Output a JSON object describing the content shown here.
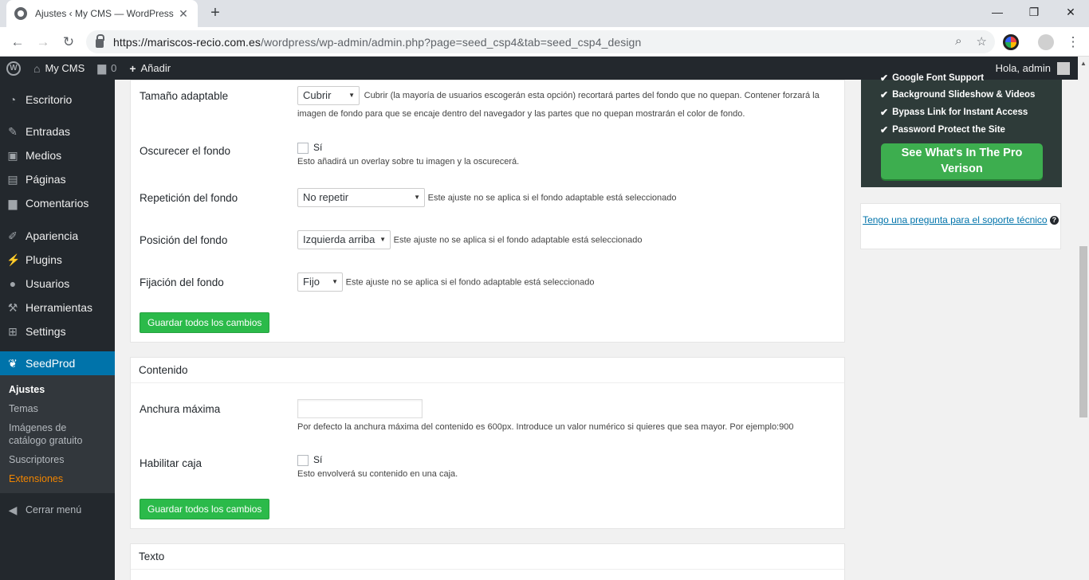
{
  "browser": {
    "tab_title": "Ajustes ‹ My CMS — WordPress",
    "url_host": "https://mariscos-recio.com.es",
    "url_path": "/wordpress/wp-admin/admin.php?page=seed_csp4&tab=seed_csp4_design"
  },
  "adminbar": {
    "site_name": "My CMS",
    "comments_count": "0",
    "add_label": "Añadir",
    "howdy": "Hola, admin"
  },
  "sidebar": {
    "items": [
      {
        "label": "Escritorio",
        "icon": "dashboard-icon"
      },
      {
        "label": "Entradas",
        "icon": "pin-icon"
      },
      {
        "label": "Medios",
        "icon": "media-icon"
      },
      {
        "label": "Páginas",
        "icon": "page-icon"
      },
      {
        "label": "Comentarios",
        "icon": "comment-icon"
      },
      {
        "label": "Apariencia",
        "icon": "brush-icon"
      },
      {
        "label": "Plugins",
        "icon": "plugin-icon"
      },
      {
        "label": "Usuarios",
        "icon": "user-icon"
      },
      {
        "label": "Herramientas",
        "icon": "wrench-icon"
      },
      {
        "label": "Settings",
        "icon": "settings-icon"
      },
      {
        "label": "SeedProd",
        "icon": "seedprod-icon"
      }
    ],
    "submenu": [
      "Ajustes",
      "Temas",
      "Imágenes de catálogo gratuito",
      "Suscriptores",
      "Extensiones"
    ],
    "collapse": "Cerrar menú"
  },
  "background": {
    "size_label": "Tamaño adaptable",
    "size_value": "Cubrir",
    "size_desc": "Cubrir (la mayoría de usuarios escogerán esta opción) recortará partes del fondo que no quepan. Contener forzará la imagen de fondo para que se encaje dentro del navegador y las partes que no quepan mostrarán el color de fondo.",
    "darken_label": "Oscurecer el fondo",
    "darken_check": "Sí",
    "darken_desc": "Esto añadirá un overlay sobre tu imagen y la oscurecerá.",
    "repeat_label": "Repetición del fondo",
    "repeat_value": "No repetir",
    "repeat_desc": "Este ajuste no se aplica si el fondo adaptable está seleccionado",
    "position_label": "Posición del fondo",
    "position_value": "Izquierda arriba",
    "position_desc": "Este ajuste no se aplica si el fondo adaptable está seleccionado",
    "attach_label": "Fijación del fondo",
    "attach_value": "Fijo",
    "attach_desc": "Este ajuste no se aplica si el fondo adaptable está seleccionado",
    "save": "Guardar todos los cambios"
  },
  "content": {
    "title": "Contenido",
    "width_label": "Anchura máxima",
    "width_value": "",
    "width_desc": "Por defecto la anchura máxima del contenido es 600px. Introduce un valor numérico si quieres que sea mayor. Por ejemplo:900",
    "box_label": "Habilitar caja",
    "box_check": "Sí",
    "box_desc": "Esto envolverá su contenido en una caja.",
    "save": "Guardar todos los cambios"
  },
  "text_section": {
    "title": "Texto"
  },
  "promo": {
    "features": [
      "Google Font Support",
      "Background Slideshow & Videos",
      "Bypass Link for Instant Access",
      "Password Protect the Site"
    ],
    "cta": "See What's In The Pro Verison"
  },
  "support": {
    "link": "Tengo una pregunta para el soporte técnico"
  },
  "colors": {
    "accent": "#0073aa",
    "button_green": "#2bba4a",
    "adminbar_bg": "#23282d",
    "extensions": "#f18500"
  }
}
